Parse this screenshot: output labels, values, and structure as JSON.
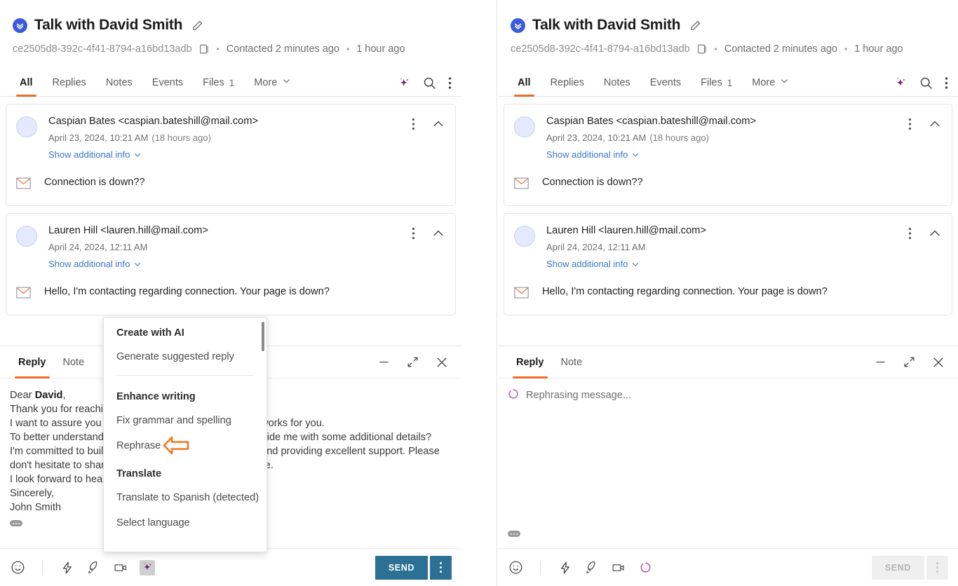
{
  "conversation": {
    "title": "Talk with David Smith",
    "id": "ce2505d8-392c-4f41-8794-a16bd13adb",
    "contacted": "Contacted 2 minutes ago",
    "last_activity": "1 hour ago",
    "channel_icon": "chevron-double-down-icon",
    "edit_icon": "pencil-icon",
    "copy_icon": "copy-icon",
    "bullet": "•"
  },
  "tabs": {
    "items": [
      {
        "label": "All",
        "count": "",
        "active": true
      },
      {
        "label": "Replies",
        "count": "",
        "active": false
      },
      {
        "label": "Notes",
        "count": "",
        "active": false
      },
      {
        "label": "Events",
        "count": "",
        "active": false
      },
      {
        "label": "Files",
        "count": "1",
        "active": false
      },
      {
        "label": "More",
        "count": "",
        "active": false
      }
    ],
    "actions": [
      "ai-sparkle-icon",
      "search-icon",
      "kebab-menu-icon"
    ]
  },
  "messages": [
    {
      "from": "Caspian Bates <caspian.bateshill@mail.com>",
      "date": "April 23, 2024, 10:21 AM",
      "relative": "(18 hours ago)",
      "show_more": "Show additional info",
      "text": "Connection is down??",
      "channel_icon": "envelope-icon"
    },
    {
      "from": "Lauren Hill <lauren.hill@mail.com>",
      "date": "April 24, 2024, 12:11 AM",
      "relative": "",
      "show_more": "Show additional info",
      "text": "Hello, I'm contacting regarding connection. Your page is down?",
      "channel_icon": "envelope-icon"
    }
  ],
  "composer": {
    "tabs": [
      {
        "label": "Reply",
        "active": true
      },
      {
        "label": "Note",
        "active": false
      }
    ],
    "window_actions": [
      "minimize-icon",
      "expand-icon",
      "close-icon"
    ],
    "left_draft": {
      "line1_a": "Dear ",
      "line1_b": "David",
      "line1_c": ",",
      "line2": "Thank you for reaching out and sharing your concerns.",
      "line3": "I want to assure you that I'm here to find a solution that works for you.",
      "line4": "To better understand the situation, could you please provide me with some additional details?",
      "line5": "I'm committed to building a strong relationship with you and providing excellent support. Please",
      "line6": "don't hesitate to share any further thoughts you may have.",
      "line7": "I look forward to hearing from you soon.",
      "line8": "Sincerely,",
      "line9": "John Smith"
    },
    "right_status": "Rephrasing message...",
    "toolbar_icons": [
      "emoji-icon",
      "lightning-icon",
      "rocket-icon",
      "video-camera-icon",
      "ai-sparkle-icon"
    ],
    "right_toolbar_icons": [
      "emoji-icon",
      "lightning-icon",
      "rocket-icon",
      "video-camera-icon",
      "spinner-icon"
    ],
    "send_label": "SEND",
    "send_caret_icon": "kebab-menu-icon"
  },
  "ai_menu": {
    "groups": [
      {
        "title": "Create with AI",
        "items": [
          "Generate suggested reply"
        ]
      },
      {
        "title": "Enhance writing",
        "items": [
          "Fix grammar and spelling",
          "Rephrase"
        ]
      },
      {
        "title": "Translate",
        "items": [
          "Translate to Spanish (detected)",
          "Select language"
        ]
      }
    ]
  },
  "annotation": {
    "shape": "left-pointing-arrow",
    "color": "#f07722"
  },
  "colors": {
    "accent_orange": "#f26a21",
    "send_teal": "#2c7194",
    "ai_purple": "#7b1f7b",
    "link_blue": "#3b78c3",
    "channel_blue": "#3b5bdb"
  }
}
